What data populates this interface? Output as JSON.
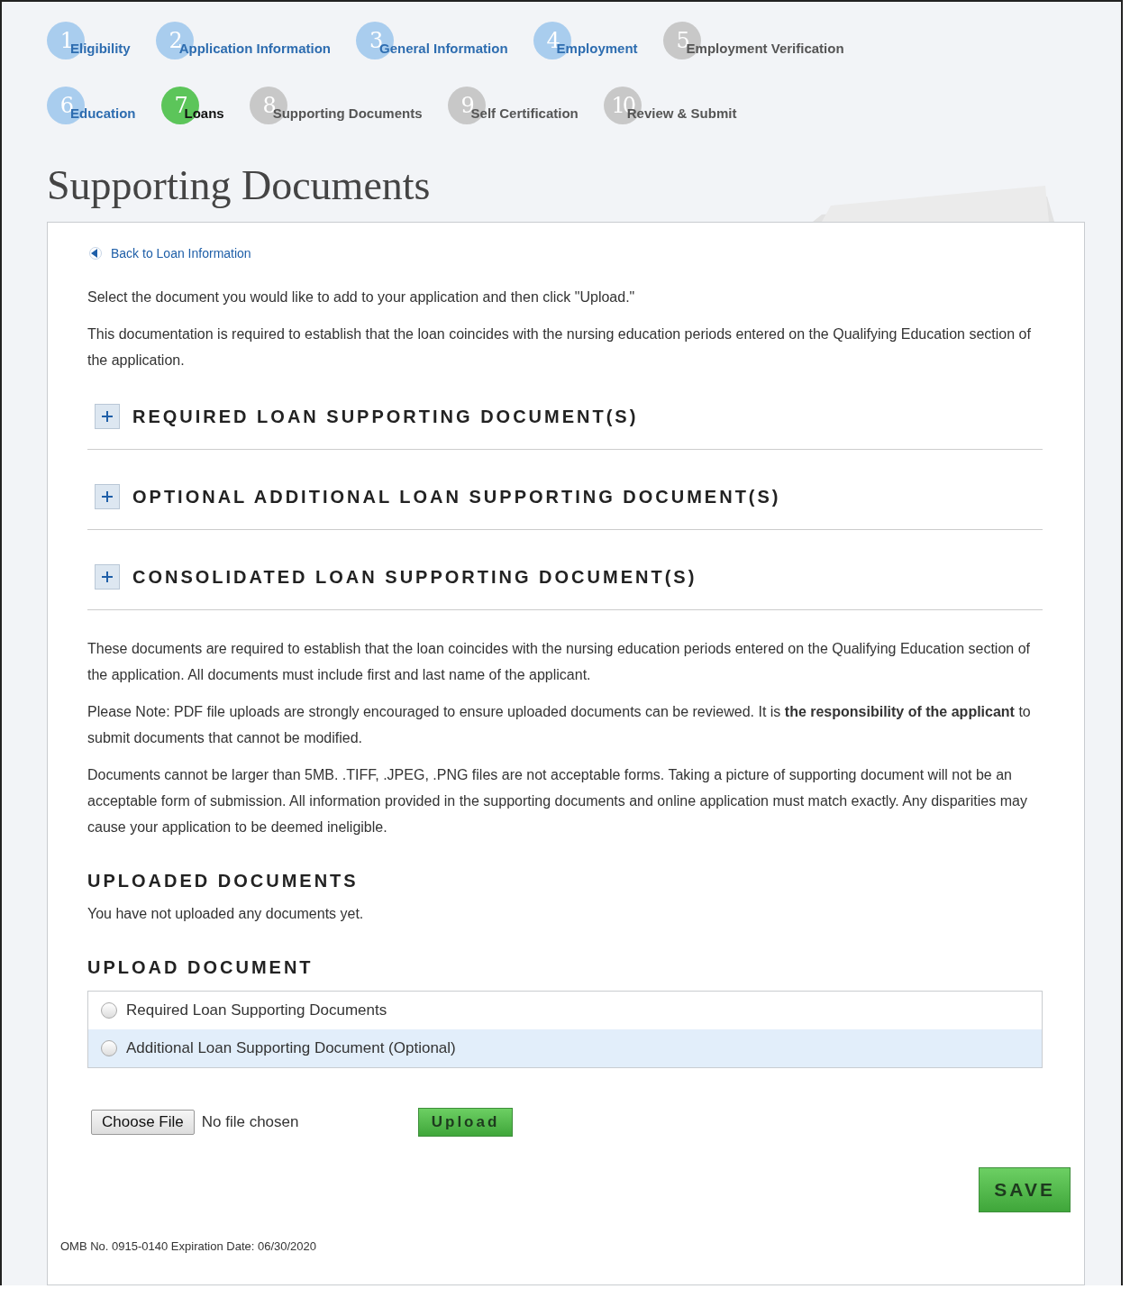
{
  "steps": [
    [
      {
        "number": "1",
        "label": "Eligibility",
        "completed": true,
        "selected": false
      },
      {
        "number": "2",
        "label": "Application Information",
        "completed": true,
        "selected": false
      },
      {
        "number": "3",
        "label": "General Information",
        "completed": true,
        "selected": false
      },
      {
        "number": "4",
        "label": "Employment",
        "completed": true,
        "selected": false
      },
      {
        "number": "5",
        "label": "Employment Verification",
        "completed": false,
        "selected": false
      }
    ],
    [
      {
        "number": "6",
        "label": "Education",
        "completed": true,
        "selected": false
      },
      {
        "number": "7",
        "label": "Loans",
        "selected": true
      },
      {
        "number": "8",
        "label": "Supporting Documents",
        "completed": false,
        "selected": false
      },
      {
        "number": "9",
        "label": "Self Certification",
        "completed": false,
        "selected": false
      },
      {
        "number": "10",
        "label": "Review & Submit",
        "completed": false,
        "selected": false
      }
    ]
  ],
  "page_title": "Supporting Documents",
  "back_link": "Back to Loan Information",
  "intro": [
    "Select the document you would like to add to your application and then click \"Upload.\"",
    "This documentation is required to establish that the loan coincides with the nursing education periods entered on the Qualifying Education section of the application."
  ],
  "sections": [
    {
      "title": "REQUIRED LOAN SUPPORTING DOCUMENT(S)",
      "expanded": false
    },
    {
      "title": "OPTIONAL ADDITIONAL LOAN SUPPORTING DOCUMENT(S)",
      "expanded": false
    },
    {
      "title": "CONSOLIDATED LOAN SUPPORTING DOCUMENT(S)",
      "expanded": false
    }
  ],
  "notes": [
    "These documents are required to establish that the loan coincides with the nursing education periods entered on the Qualifying Education section of the application. All documents must include first and last name of the applicant.",
    "Please Note: PDF file uploads are strongly encouraged to ensure uploaded documents can be reviewed. It is **the responsibility of the applicant** to submit documents that cannot be modified.",
    "Documents cannot be larger than 5MB. .TIFF, .JPEG, .PNG files are not acceptable forms. Taking a picture of supporting document will not be an acceptable form of submission. All information provided in the supporting documents and online application must match exactly. Any disparities may cause your application to be deemed ineligible."
  ],
  "uploaded": {
    "heading": "UPLOADED DOCUMENTS",
    "empty_text": "You have not uploaded any documents yet."
  },
  "upload": {
    "heading": "UPLOAD DOCUMENT",
    "options": [
      {
        "label": "Required Loan Supporting Documents",
        "selected": false,
        "highlighted": false
      },
      {
        "label": "Additional Loan Supporting Document (Optional)",
        "selected": false,
        "highlighted": true
      }
    ],
    "choose_button": "Choose File",
    "file_status": "No file chosen",
    "upload_button": "Upload"
  },
  "save_button": "SAVE",
  "footer": "OMB No. 0915-0140 Expiration Date: 06/30/2020"
}
